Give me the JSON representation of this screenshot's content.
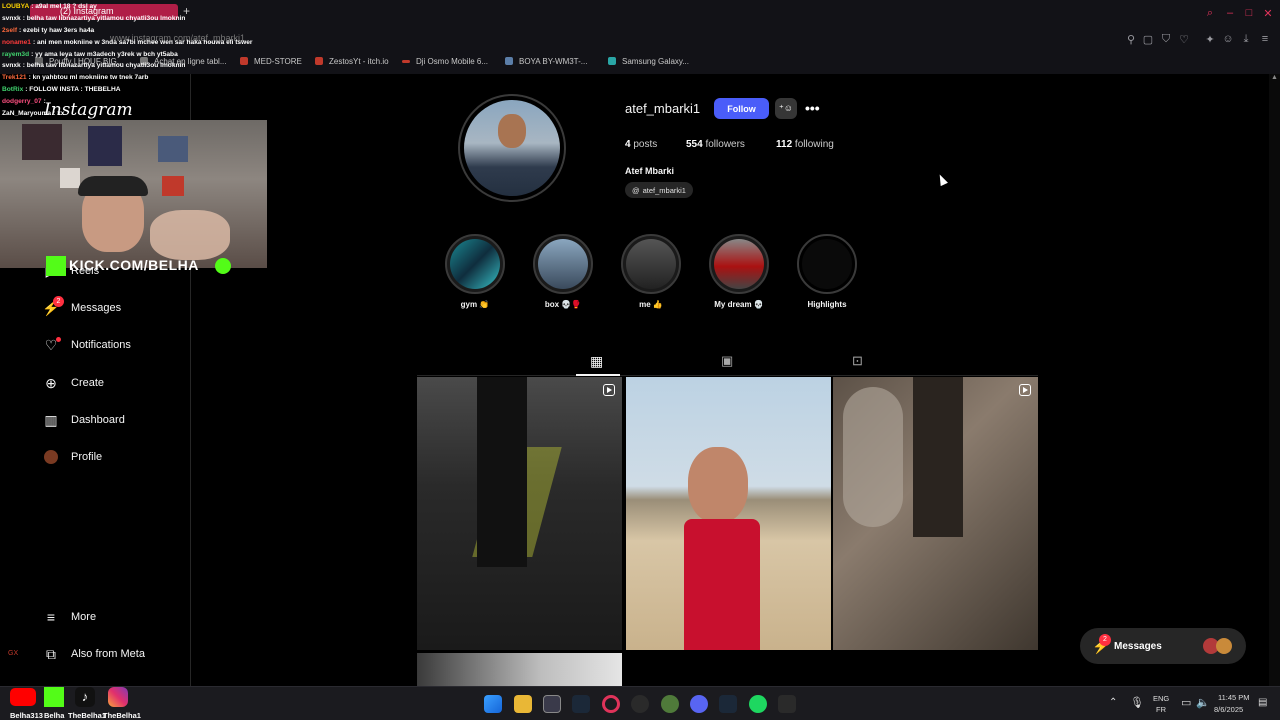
{
  "browser": {
    "tab_label": "(2) Instagram",
    "tab_badge": "2",
    "url": "www.instagram.com/atef_mbarki1"
  },
  "bookmarks": [
    "Pouffy | HOUF BIG...",
    "Achat en ligne tabl...",
    "MED-STORE",
    "ZestosYt - itch.io",
    "Dji Osmo Mobile 6...",
    "BOYA BY-WM3T-...",
    "Samsung Galaxy..."
  ],
  "chat": [
    {
      "user": "LOUBYA",
      "text": ": a9al mel 18 ? dsl ay",
      "color": "#ffd400"
    },
    {
      "user": "svnxk",
      "text": ": belha taw libnazartiya yitlamou chyatli3ou lmoknin",
      "color": "#ffffff"
    },
    {
      "user": "2self",
      "text": ": ezebi ty haw 3ers ha4a",
      "color": "#ff6a3d"
    },
    {
      "user": "noname1",
      "text": ": ani men mokniine w 3nda sa7bi mchee wen sar haka houwa eli tswer",
      "color": "#ff3b3b"
    },
    {
      "user": "rayem3d",
      "text": ": yy ama leya taw m3adech y3rek w bch yt5aba",
      "color": "#40d36e"
    },
    {
      "user": "svnxk",
      "text": ": belha taw libnazartiya yitlamou chyatli3ou lmoknin",
      "color": "#ffffff"
    },
    {
      "user": "Trek121",
      "text": ": kn yahbtou ml mokniine tw tnek 7arb",
      "color": "#ff6a3d"
    },
    {
      "user": "BotRix",
      "text": ": FOLLOW INSTA : THEBELHA",
      "color": "#40d36e"
    },
    {
      "user": "dodgerry_07",
      "text": ": ",
      "color": "#ff4f81"
    },
    {
      "user": "ZaN_Maryouma",
      "text": ": xx",
      "color": "#ffffff"
    }
  ],
  "overlay": {
    "kick_text": "KICK.COM/BELHA",
    "socials": [
      "Belha313",
      "Belha",
      "TheBelha1",
      "TheBelha1"
    ]
  },
  "sidebar": {
    "logo": "Instagram",
    "items": [
      {
        "label": "Reels",
        "icon": "reels-icon"
      },
      {
        "label": "Messages",
        "icon": "messenger-icon",
        "badge": "2"
      },
      {
        "label": "Notifications",
        "icon": "heart-icon"
      },
      {
        "label": "Create",
        "icon": "plus-square-icon"
      },
      {
        "label": "Dashboard",
        "icon": "chart-icon"
      },
      {
        "label": "Profile",
        "icon": "avatar-icon"
      }
    ],
    "more": "More",
    "also_from_meta": "Also from Meta"
  },
  "profile": {
    "username": "atef_mbarki1",
    "follow_label": "Follow",
    "posts_count": "4",
    "posts_label": "posts",
    "followers_count": "554",
    "followers_label": "followers",
    "following_count": "112",
    "following_label": "following",
    "full_name": "Atef Mbarki",
    "threads_handle": "atef_mbarki1"
  },
  "highlights": [
    {
      "label": "gym 👏"
    },
    {
      "label": "box 💀🥊"
    },
    {
      "label": "me 👍"
    },
    {
      "label": "My dream 💀"
    },
    {
      "label": "Highlights"
    }
  ],
  "tabs": [
    "posts-grid",
    "reels",
    "tagged"
  ],
  "messages_pill": {
    "label": "Messages",
    "badge": "2"
  },
  "taskbar": {
    "lang_top": "ENG",
    "lang_bottom": "FR",
    "time": "11:45 PM",
    "date": "8/6/2025"
  },
  "colors": {
    "accent": "#4a5df9",
    "bg": "#000000",
    "badge": "#ff3040"
  }
}
